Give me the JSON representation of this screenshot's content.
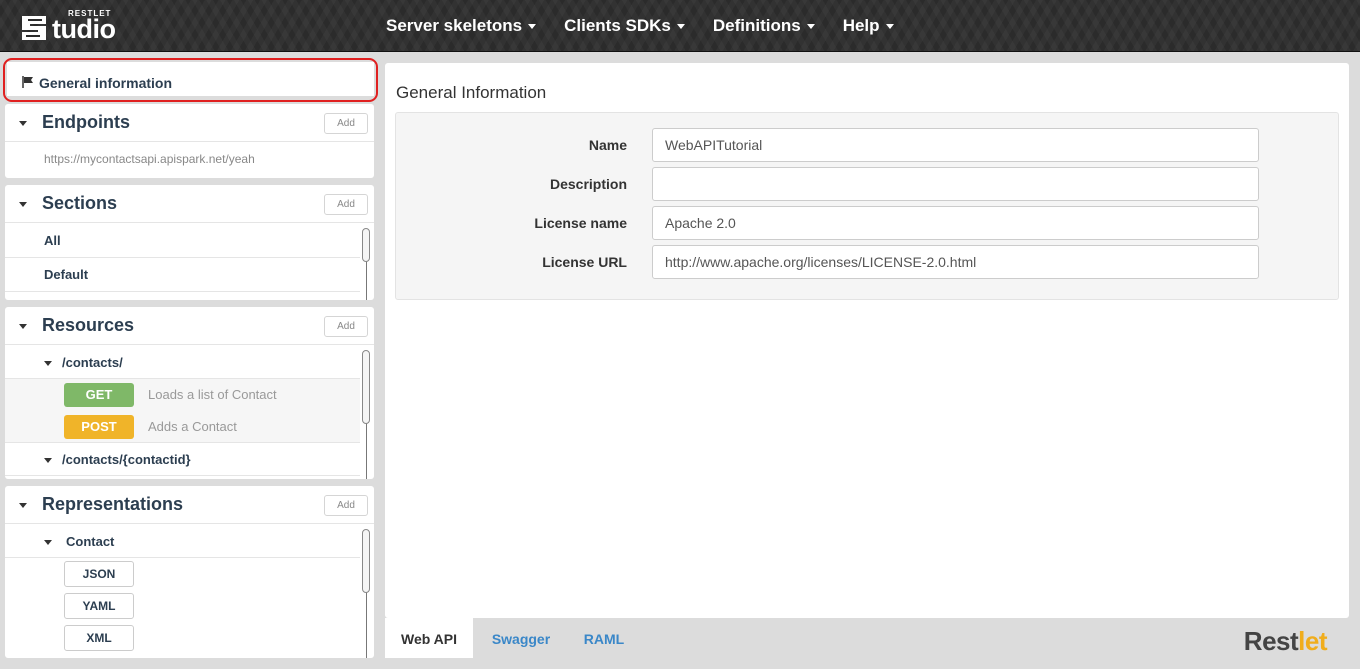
{
  "header": {
    "logo_small": "RESTLET",
    "logo_text": "tudio",
    "nav": [
      {
        "label": "Server skeletons"
      },
      {
        "label": "Clients SDKs"
      },
      {
        "label": "Definitions"
      },
      {
        "label": "Help"
      }
    ]
  },
  "sidebar": {
    "general": {
      "label": "General information"
    },
    "endpoints": {
      "title": "Endpoints",
      "add_label": "Add",
      "url": "https://mycontactsapi.apispark.net/yeah"
    },
    "sections": {
      "title": "Sections",
      "add_label": "Add",
      "items": [
        {
          "label": "All"
        },
        {
          "label": "Default"
        }
      ]
    },
    "resources": {
      "title": "Resources",
      "add_label": "Add",
      "items": [
        {
          "path": "/contacts/",
          "methods": [
            {
              "method": "GET",
              "description": "Loads a list of Contact",
              "color": "#7fb868"
            },
            {
              "method": "POST",
              "description": "Adds a Contact",
              "color": "#f0b429"
            }
          ]
        },
        {
          "path": "/contacts/{contactid}"
        }
      ]
    },
    "representations": {
      "title": "Representations",
      "add_label": "Add",
      "items": [
        {
          "name": "Contact",
          "formats": [
            "JSON",
            "YAML",
            "XML"
          ]
        }
      ]
    }
  },
  "main": {
    "title": "General Information",
    "fields": {
      "name": {
        "label": "Name",
        "value": "WebAPITutorial"
      },
      "description": {
        "label": "Description",
        "value": ""
      },
      "license_name": {
        "label": "License name",
        "value": "Apache 2.0"
      },
      "license_url": {
        "label": "License URL",
        "value": "http://www.apache.org/licenses/LICENSE-2.0.html"
      }
    }
  },
  "tabs": [
    {
      "label": "Web API",
      "active": true
    },
    {
      "label": "Swagger"
    },
    {
      "label": "RAML"
    }
  ],
  "brand": {
    "text_main": "Rest",
    "text_accent": "let"
  },
  "colors": {
    "accent": "#3a87c8",
    "highlight": "#e02020",
    "get": "#7fb868",
    "post": "#f0b429"
  }
}
